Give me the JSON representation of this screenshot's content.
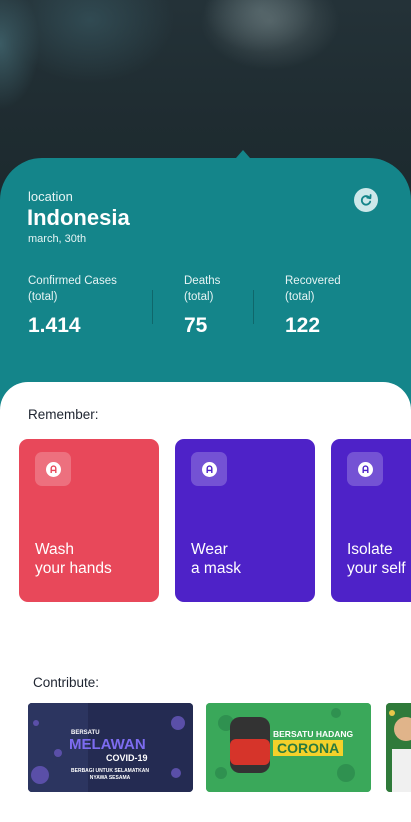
{
  "location": {
    "label": "location",
    "country": "Indonesia",
    "date": "march, 30th"
  },
  "stats": {
    "confirmed": {
      "label_line1": "Confirmed Cases",
      "label_line2": "(total)",
      "value": "1.414"
    },
    "deaths": {
      "label_line1": "Deaths",
      "label_line2": "(total)",
      "value": "75"
    },
    "recovered": {
      "label_line1": "Recovered",
      "label_line2": "(total)",
      "value": "122"
    }
  },
  "remember": {
    "title": "Remember:",
    "cards": [
      {
        "line1": "Wash",
        "line2": "your hands",
        "color": "#e8485a"
      },
      {
        "line1": "Wear",
        "line2": "a mask",
        "color": "#4e22c8"
      },
      {
        "line1": "Isolate",
        "line2": "your self",
        "color": "#4e22c8"
      }
    ]
  },
  "contribute": {
    "title": "Contribute:",
    "banners": [
      {
        "top_text": "BERSATU",
        "main_text": "MELAWAN",
        "sub_text": "COVID-19",
        "footer_line1": "BERBAGI UNTUK SELAMATKAN",
        "footer_line2": "NYAWA SESAMA",
        "color": "#242b52"
      },
      {
        "top_text": "BERSATU HADANG",
        "main_text": "CORONA",
        "color": "#3aa85a"
      }
    ]
  },
  "colors": {
    "teal": "#14858a",
    "red": "#e8485a",
    "purple": "#4e22c8"
  }
}
